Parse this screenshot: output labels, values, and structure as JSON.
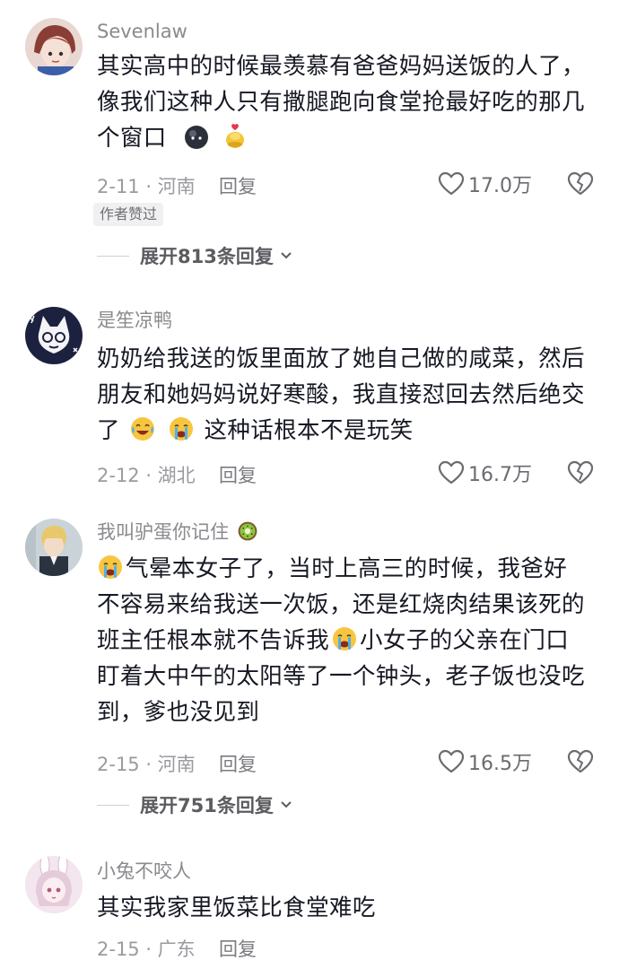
{
  "comments": [
    {
      "username": "Sevenlaw",
      "text1": "其实高中的时候最羡慕有爸爸妈妈送饭的人了，",
      "text2": "像我们这种人只有撒腿跑向食堂抢最好吃的那几",
      "text3": "个窗口",
      "date": "2-11 · 河南",
      "reply": "回复",
      "likes": "17.0万",
      "author_tag": "作者赞过",
      "expand": "展开813条回复"
    },
    {
      "username": "是笙凉鸭",
      "text1": "奶奶给我送的饭里面放了她自己做的咸菜，然后",
      "text2": "朋友和她妈妈说好寒酸，我直接怼回去然后绝交",
      "text3a": "了",
      "text3b": "这种话根本不是玩笑",
      "date": "2-12 · 湖北",
      "reply": "回复",
      "likes": "16.7万"
    },
    {
      "username": "我叫驴蛋你记住",
      "text1": "气晕本女子了，当时上高三的时候，我爸好",
      "text2": "不容易来给我送一次饭，还是红烧肉结果该死的",
      "text3a": "班主任根本就不告诉我",
      "text3b": "小女子的父亲在门口",
      "text4": "盯着大中午的太阳等了一个钟头，老子饭也没吃",
      "text5": "到，爹也没见到",
      "date": "2-15 · 河南",
      "reply": "回复",
      "likes": "16.5万",
      "expand": "展开751条回复"
    },
    {
      "username": "小兔不咬人",
      "text1": "其实我家里饭菜比食堂难吃",
      "date": "2-15 · 广东",
      "reply": "回复"
    }
  ],
  "icons": {
    "like": "heart-outline-icon",
    "dislike": "broken-heart-icon",
    "expand": "chevron-down-icon"
  }
}
